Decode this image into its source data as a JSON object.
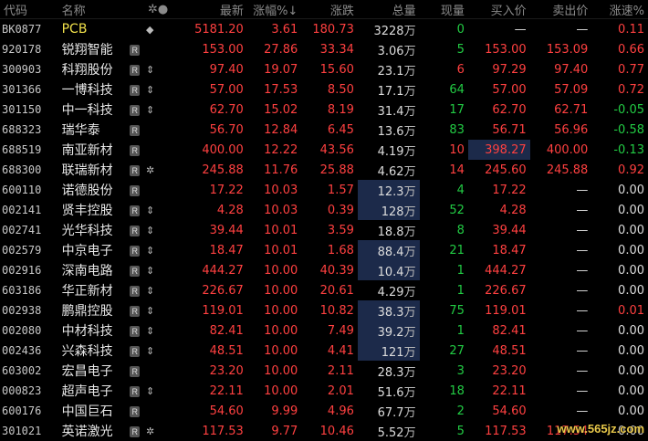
{
  "headers": {
    "code": "代码",
    "name": "名称",
    "marks": "✲●",
    "price": "最新",
    "pct": "涨幅%↓",
    "change": "涨跌",
    "volume": "总量",
    "current": "现量",
    "bid": "买入价",
    "ask": "卖出价",
    "speed": "涨速%"
  },
  "rows": [
    {
      "code": "BK0877",
      "name": "PCB",
      "badge": "",
      "mark": "◆",
      "price": "5181.20",
      "pct": "3.61",
      "change": "180.73",
      "volume": "3228",
      "unit": "万",
      "current": "0",
      "bid": "—",
      "ask": "—",
      "speed": "0.11",
      "speed_dir": "red",
      "cur_dir": "green",
      "vol_hl": false,
      "bid_hl": false
    },
    {
      "code": "920178",
      "name": "锐翔智能",
      "badge": "R",
      "mark": "",
      "price": "153.00",
      "pct": "27.86",
      "change": "33.34",
      "volume": "3.06",
      "unit": "万",
      "current": "5",
      "bid": "153.00",
      "ask": "153.09",
      "speed": "0.66",
      "speed_dir": "red",
      "cur_dir": "green",
      "vol_hl": false,
      "bid_hl": false
    },
    {
      "code": "300903",
      "name": "科翔股份",
      "badge": "R",
      "mark": "⇕",
      "price": "97.40",
      "pct": "19.07",
      "change": "15.60",
      "volume": "23.1",
      "unit": "万",
      "current": "6",
      "bid": "97.29",
      "ask": "97.40",
      "speed": "0.77",
      "speed_dir": "red",
      "cur_dir": "red",
      "vol_hl": false,
      "bid_hl": false
    },
    {
      "code": "301366",
      "name": "一博科技",
      "badge": "R",
      "mark": "⇕",
      "price": "57.00",
      "pct": "17.53",
      "change": "8.50",
      "volume": "17.1",
      "unit": "万",
      "current": "64",
      "bid": "57.00",
      "ask": "57.09",
      "speed": "0.72",
      "speed_dir": "red",
      "cur_dir": "green",
      "vol_hl": false,
      "bid_hl": false
    },
    {
      "code": "301150",
      "name": "中一科技",
      "badge": "R",
      "mark": "⇕",
      "price": "62.70",
      "pct": "15.02",
      "change": "8.19",
      "volume": "31.4",
      "unit": "万",
      "current": "17",
      "bid": "62.70",
      "ask": "62.71",
      "speed": "-0.05",
      "speed_dir": "green",
      "cur_dir": "green",
      "vol_hl": false,
      "bid_hl": false
    },
    {
      "code": "688323",
      "name": "瑞华泰",
      "badge": "R",
      "mark": "",
      "price": "56.70",
      "pct": "12.84",
      "change": "6.45",
      "volume": "13.6",
      "unit": "万",
      "current": "83",
      "bid": "56.71",
      "ask": "56.96",
      "speed": "-0.58",
      "speed_dir": "green",
      "cur_dir": "green",
      "vol_hl": false,
      "bid_hl": false
    },
    {
      "code": "688519",
      "name": "南亚新材",
      "badge": "R",
      "mark": "",
      "price": "400.00",
      "pct": "12.22",
      "change": "43.56",
      "volume": "4.19",
      "unit": "万",
      "current": "10",
      "bid": "398.27",
      "ask": "400.00",
      "speed": "-0.13",
      "speed_dir": "green",
      "cur_dir": "red",
      "vol_hl": false,
      "bid_hl": true
    },
    {
      "code": "688300",
      "name": "联瑞新材",
      "badge": "R",
      "mark": "✲",
      "price": "245.88",
      "pct": "11.76",
      "change": "25.88",
      "volume": "4.62",
      "unit": "万",
      "current": "14",
      "bid": "245.60",
      "ask": "245.88",
      "speed": "0.92",
      "speed_dir": "red",
      "cur_dir": "red",
      "vol_hl": false,
      "bid_hl": false
    },
    {
      "code": "600110",
      "name": "诺德股份",
      "badge": "R",
      "mark": "",
      "price": "17.22",
      "pct": "10.03",
      "change": "1.57",
      "volume": "12.3",
      "unit": "万",
      "current": "4",
      "bid": "17.22",
      "ask": "—",
      "speed": "0.00",
      "speed_dir": "white",
      "cur_dir": "green",
      "vol_hl": true,
      "bid_hl": false
    },
    {
      "code": "002141",
      "name": "贤丰控股",
      "badge": "R",
      "mark": "⇕",
      "price": "4.28",
      "pct": "10.03",
      "change": "0.39",
      "volume": "128",
      "unit": "万",
      "current": "52",
      "bid": "4.28",
      "ask": "—",
      "speed": "0.00",
      "speed_dir": "white",
      "cur_dir": "green",
      "vol_hl": true,
      "bid_hl": false
    },
    {
      "code": "002741",
      "name": "光华科技",
      "badge": "R",
      "mark": "⇕",
      "price": "39.44",
      "pct": "10.01",
      "change": "3.59",
      "volume": "18.8",
      "unit": "万",
      "current": "8",
      "bid": "39.44",
      "ask": "—",
      "speed": "0.00",
      "speed_dir": "white",
      "cur_dir": "green",
      "vol_hl": false,
      "bid_hl": false
    },
    {
      "code": "002579",
      "name": "中京电子",
      "badge": "R",
      "mark": "⇕",
      "price": "18.47",
      "pct": "10.01",
      "change": "1.68",
      "volume": "88.4",
      "unit": "万",
      "current": "21",
      "bid": "18.47",
      "ask": "—",
      "speed": "0.00",
      "speed_dir": "white",
      "cur_dir": "green",
      "vol_hl": true,
      "bid_hl": false
    },
    {
      "code": "002916",
      "name": "深南电路",
      "badge": "R",
      "mark": "⇕",
      "price": "444.27",
      "pct": "10.00",
      "change": "40.39",
      "volume": "10.4",
      "unit": "万",
      "current": "1",
      "bid": "444.27",
      "ask": "—",
      "speed": "0.00",
      "speed_dir": "white",
      "cur_dir": "green",
      "vol_hl": true,
      "bid_hl": false
    },
    {
      "code": "603186",
      "name": "华正新材",
      "badge": "R",
      "mark": "⇕",
      "price": "226.67",
      "pct": "10.00",
      "change": "20.61",
      "volume": "4.29",
      "unit": "万",
      "current": "1",
      "bid": "226.67",
      "ask": "—",
      "speed": "0.00",
      "speed_dir": "white",
      "cur_dir": "green",
      "vol_hl": false,
      "bid_hl": false
    },
    {
      "code": "002938",
      "name": "鹏鼎控股",
      "badge": "R",
      "mark": "⇕",
      "price": "119.01",
      "pct": "10.00",
      "change": "10.82",
      "volume": "38.3",
      "unit": "万",
      "current": "75",
      "bid": "119.01",
      "ask": "—",
      "speed": "0.01",
      "speed_dir": "red",
      "cur_dir": "green",
      "vol_hl": true,
      "bid_hl": false
    },
    {
      "code": "002080",
      "name": "中材科技",
      "badge": "R",
      "mark": "⇕",
      "price": "82.41",
      "pct": "10.00",
      "change": "7.49",
      "volume": "39.2",
      "unit": "万",
      "current": "1",
      "bid": "82.41",
      "ask": "—",
      "speed": "0.00",
      "speed_dir": "white",
      "cur_dir": "green",
      "vol_hl": true,
      "bid_hl": false
    },
    {
      "code": "002436",
      "name": "兴森科技",
      "badge": "R",
      "mark": "⇕",
      "price": "48.51",
      "pct": "10.00",
      "change": "4.41",
      "volume": "121",
      "unit": "万",
      "current": "27",
      "bid": "48.51",
      "ask": "—",
      "speed": "0.00",
      "speed_dir": "white",
      "cur_dir": "green",
      "vol_hl": true,
      "bid_hl": false
    },
    {
      "code": "603002",
      "name": "宏昌电子",
      "badge": "R",
      "mark": "",
      "price": "23.20",
      "pct": "10.00",
      "change": "2.11",
      "volume": "28.3",
      "unit": "万",
      "current": "3",
      "bid": "23.20",
      "ask": "—",
      "speed": "0.00",
      "speed_dir": "white",
      "cur_dir": "green",
      "vol_hl": false,
      "bid_hl": false
    },
    {
      "code": "000823",
      "name": "超声电子",
      "badge": "R",
      "mark": "⇕",
      "price": "22.11",
      "pct": "10.00",
      "change": "2.01",
      "volume": "51.6",
      "unit": "万",
      "current": "18",
      "bid": "22.11",
      "ask": "—",
      "speed": "0.00",
      "speed_dir": "white",
      "cur_dir": "green",
      "vol_hl": false,
      "bid_hl": false
    },
    {
      "code": "600176",
      "name": "中国巨石",
      "badge": "R",
      "mark": "",
      "price": "54.60",
      "pct": "9.99",
      "change": "4.96",
      "volume": "67.7",
      "unit": "万",
      "current": "2",
      "bid": "54.60",
      "ask": "—",
      "speed": "0.00",
      "speed_dir": "white",
      "cur_dir": "green",
      "vol_hl": false,
      "bid_hl": false
    },
    {
      "code": "301021",
      "name": "英诺激光",
      "badge": "R",
      "mark": "✲",
      "price": "117.53",
      "pct": "9.77",
      "change": "10.46",
      "volume": "5.52",
      "unit": "万",
      "current": "5",
      "bid": "117.53",
      "ask": "117.54",
      "speed": "0.00",
      "speed_dir": "white",
      "cur_dir": "green",
      "vol_hl": false,
      "bid_hl": false
    }
  ],
  "watermark": "www.565jz.com",
  "colors": {
    "up": "#ff4040",
    "down": "#22cc44",
    "flat": "#dcdcdc",
    "bg": "#000000",
    "highlight": "#1c2a4a"
  }
}
